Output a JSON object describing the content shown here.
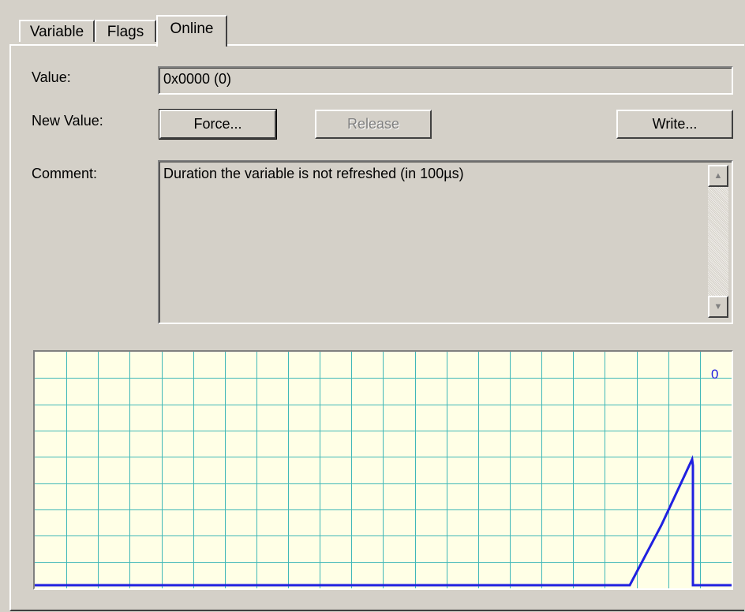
{
  "tabs": [
    {
      "label": "Variable",
      "active": false
    },
    {
      "label": "Flags",
      "active": false
    },
    {
      "label": "Online",
      "active": true
    }
  ],
  "value": {
    "label": "Value:",
    "field_value": "0x0000 (0)"
  },
  "new_value": {
    "label": "New Value:",
    "force_label": "Force...",
    "release_label": "Release",
    "write_label": "Write..."
  },
  "comment": {
    "label": "Comment:",
    "text": "Duration the variable is not refreshed (in 100µs)"
  },
  "chart_data": {
    "type": "line",
    "current_value_label": "0",
    "x": [
      0,
      1,
      2,
      3,
      4,
      5,
      6,
      7,
      8,
      9,
      10,
      11,
      12,
      13,
      14,
      15,
      16,
      17,
      18,
      19,
      20,
      21,
      22
    ],
    "series": [
      {
        "values": [
          0,
          0,
          0,
          0,
          0,
          0,
          0,
          0,
          0,
          0,
          0,
          0,
          0,
          0,
          0,
          0,
          0,
          0,
          0,
          0,
          2,
          4.2,
          0
        ]
      }
    ],
    "ylim": [
      0,
      7
    ],
    "grid": true,
    "colors": {
      "line": "#2020e0",
      "grid": "#40b8b8",
      "background": "#ffffe6",
      "label": "#2020e0"
    }
  }
}
